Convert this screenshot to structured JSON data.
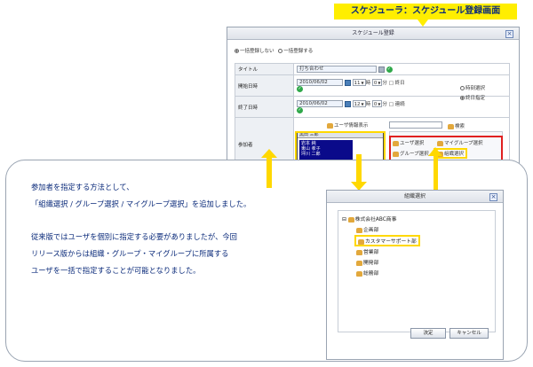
{
  "banner": {
    "text": "スケジューラ：スケジュール登録画面"
  },
  "window": {
    "title": "スケジュール登録",
    "close": "×",
    "radio_bulk_off": "一括登録しない",
    "radio_bulk_on": "一括登録する",
    "fields": {
      "title_label": "タイトル",
      "title_value": "打ち合わせ",
      "start_label": "開始日時",
      "start_date": "2010/06/02",
      "start_hour": "11",
      "start_hour_unit": "時",
      "start_min": "0",
      "start_min_unit": "分",
      "start_allday": "□ 終日",
      "end_label": "終了日時",
      "end_date": "2010/06/02",
      "end_hour": "12",
      "end_hour_unit": "時",
      "end_min": "0",
      "end_min_unit": "分",
      "end_repeat": "□ 連続",
      "time_select": "時刻選択",
      "date_specify": "終日指定",
      "participants_label": "参加者"
    },
    "participants": {
      "head": "黒田 三郎",
      "user_info_display": "ユーザ情報表示",
      "selected": [
        "岩本 純",
        "東山 孝子",
        "坪川 二郎"
      ]
    },
    "search_label": "検索",
    "select_buttons": {
      "user": "ユーザ選択",
      "my_group": "マイグループ選択",
      "group": "グループ選択",
      "org": "組織選択"
    }
  },
  "note": {
    "lines": [
      "参加者を指定する方法として、",
      "「組織選択 / グループ選択 / マイグループ選択」を追加しました。",
      "",
      "従来版ではユーザを個別に指定する必要がありましたが、今回",
      "リリース版からは組織・グループ・マイグループに所属する",
      "ユーザを一括で指定することが可能となりました。"
    ]
  },
  "dialog": {
    "title": "組織選択",
    "close": "×",
    "tree": {
      "root": "株式会社ABC商事",
      "children": [
        "企画部",
        "カスタマーサポート部",
        "営業部",
        "開発部",
        "総務部"
      ]
    },
    "ok": "決定",
    "cancel": "キャンセル"
  },
  "colors": {
    "banner_bg": "#ffee00",
    "banner_text": "#0a2a7a",
    "highlight_red": "#e02020",
    "highlight_yellow": "#ffd800",
    "note_text": "#0a2a7a"
  }
}
